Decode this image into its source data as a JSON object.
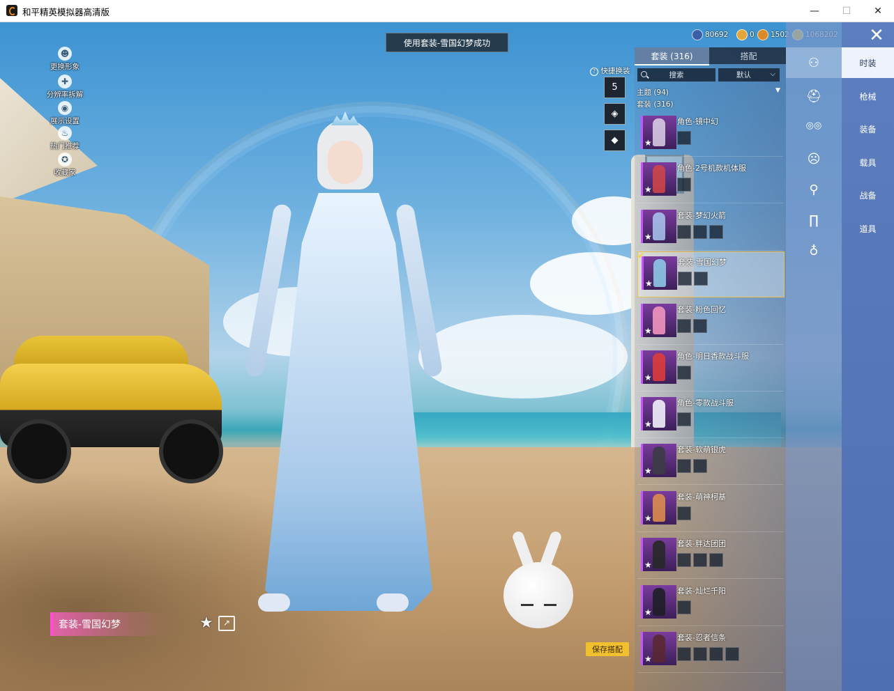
{
  "window": {
    "title": "和平精英模拟器高清版",
    "min": "—",
    "max": "☐",
    "close": "✕"
  },
  "toast": "使用套装-雪国幻梦成功",
  "left_menu": [
    {
      "label": "更换形象",
      "icon": "person-icon",
      "glyph": "☻"
    },
    {
      "label": "分辨率拆解",
      "icon": "split-icon",
      "glyph": "✚"
    },
    {
      "label": "展示设置",
      "icon": "eye-icon",
      "glyph": "◉"
    },
    {
      "label": "热门推荐",
      "icon": "flame-icon",
      "glyph": "♨"
    },
    {
      "label": "收藏家",
      "icon": "collector-icon",
      "glyph": "✪"
    }
  ],
  "quick": {
    "label": "快捷换装",
    "help": "?",
    "btn1": "5",
    "btn2": "◈",
    "btn3": "◆"
  },
  "currencies": [
    {
      "value": "80692",
      "color": "#3d5fa8",
      "icon": "globe-coin-icon"
    },
    {
      "value": "0",
      "color": "#e0a63a",
      "icon": "gold-coin-icon"
    },
    {
      "value": "1502",
      "color": "#d98b2a",
      "icon": "token-icon"
    },
    {
      "value": "1068202",
      "color": "#e8c24a",
      "icon": "bp-coin-icon"
    }
  ],
  "panel": {
    "tab_active": "套装 (316)",
    "tab_other": "搭配",
    "search": "搜索",
    "sort": "默认",
    "theme": "主题 (94)",
    "set": "套装 (316)",
    "items": [
      {
        "name": "角色-镜中幻",
        "parts": 1,
        "selected": false
      },
      {
        "name": "角色-2号机款机体服",
        "parts": 1,
        "selected": false
      },
      {
        "name": "套装-梦幻火箭",
        "parts": 3,
        "selected": false
      },
      {
        "name": "套装-雪国幻梦",
        "parts": 2,
        "selected": true
      },
      {
        "name": "套装-粉色回忆",
        "parts": 2,
        "selected": false
      },
      {
        "name": "角色-明日香款战斗服",
        "parts": 1,
        "selected": false
      },
      {
        "name": "角色-零款战斗服",
        "parts": 1,
        "selected": false
      },
      {
        "name": "套装-软萌银虎",
        "parts": 2,
        "selected": false
      },
      {
        "name": "套装-萌神柯基",
        "parts": 1,
        "selected": false
      },
      {
        "name": "套装-胖达团团",
        "parts": 3,
        "selected": false
      },
      {
        "name": "套装-灿烂千阳",
        "parts": 1,
        "selected": false
      },
      {
        "name": "套装-忍者信条",
        "parts": 4,
        "selected": false
      }
    ]
  },
  "categories": [
    {
      "icon": "outfit-icon",
      "glyph": "⚇",
      "active": true
    },
    {
      "icon": "helmet-icon",
      "glyph": "⛑",
      "active": false
    },
    {
      "icon": "glasses-icon",
      "glyph": "◎◎",
      "active": false
    },
    {
      "icon": "mask-icon",
      "glyph": "☹",
      "active": false
    },
    {
      "icon": "top-icon",
      "glyph": "⚲",
      "active": false
    },
    {
      "icon": "pants-icon",
      "glyph": "∏",
      "active": false
    },
    {
      "icon": "shoes-icon",
      "glyph": "♁",
      "active": false
    }
  ],
  "nav": {
    "close": "✕",
    "items": [
      "时装",
      "枪械",
      "装备",
      "载具",
      "战备",
      "道具"
    ],
    "active_index": 0
  },
  "outfit_label": "套装-雪国幻梦",
  "star": "★",
  "share": "↗",
  "save_button": "保存搭配"
}
